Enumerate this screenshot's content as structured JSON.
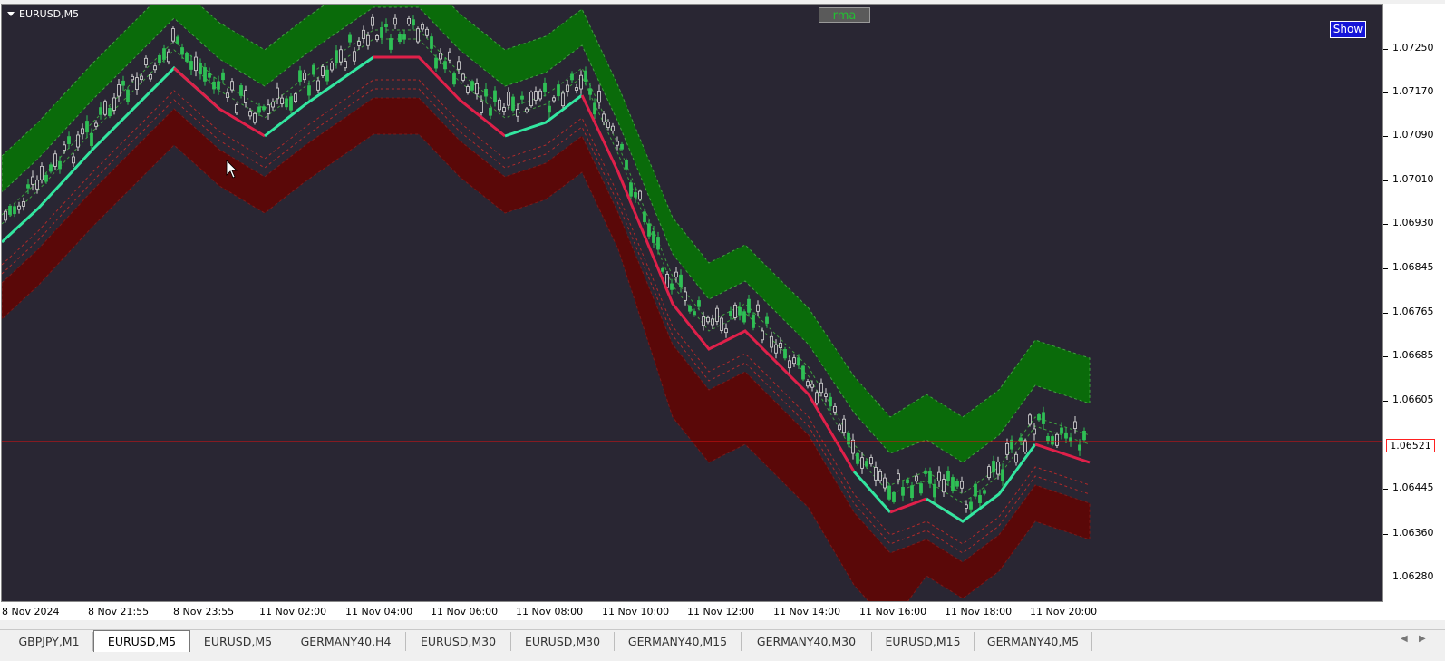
{
  "chart": {
    "symbol_title": "EURUSD,M5",
    "indicator_label": "rma",
    "show_button": "Show",
    "current_price": "1.06521",
    "price_ticks": [
      "1.07250",
      "1.07170",
      "1.07090",
      "1.07010",
      "1.06930",
      "1.06845",
      "1.06765",
      "1.06685",
      "1.06605",
      "1.06445",
      "1.06360",
      "1.06280"
    ],
    "time_ticks": [
      "8 Nov 2024",
      "8 Nov 21:55",
      "8 Nov 23:55",
      "11 Nov 02:00",
      "11 Nov 04:00",
      "11 Nov 06:00",
      "11 Nov 08:00",
      "11 Nov 10:00",
      "11 Nov 12:00",
      "11 Nov 14:00",
      "11 Nov 16:00",
      "11 Nov 18:00",
      "11 Nov 20:00"
    ],
    "colors": {
      "background": "#292633",
      "upper_band": "#0a6b0a",
      "lower_band": "#5a0808",
      "ma_up": "#33e6a0",
      "ma_down": "#e0204a",
      "price_line": "#e01010",
      "candle_up": "#2fbf55",
      "candle_down": "#d8d8d8"
    }
  },
  "chart_data": {
    "type": "line",
    "title": "EURUSD,M5",
    "x": [
      "8 Nov 2024",
      "8 Nov 21:55",
      "8 Nov 23:55",
      "11 Nov 02:00",
      "11 Nov 04:00",
      "11 Nov 06:00",
      "11 Nov 08:00",
      "11 Nov 10:00",
      "11 Nov 12:00",
      "11 Nov 14:00",
      "11 Nov 16:00",
      "11 Nov 18:00",
      "11 Nov 20:00"
    ],
    "ylim": [
      1.0622,
      1.0735
    ],
    "series": [
      {
        "name": "rma",
        "values": [
          1.0692,
          1.0712,
          1.0722,
          1.0711,
          1.0725,
          1.0712,
          1.0717,
          1.0688,
          1.0671,
          1.065,
          1.064,
          1.0638,
          1.0652
        ]
      },
      {
        "values": [
          1.0715,
          1.0722,
          1.0726,
          1.0716,
          1.0728,
          1.0716,
          1.0719,
          1.0693,
          1.0677,
          1.0655,
          1.065,
          1.0649,
          1.0655
        ]
      }
    ],
    "current_price": 1.06521,
    "grid": false
  },
  "tabs": [
    {
      "label": "GBPJPY,M1",
      "active": false
    },
    {
      "label": "EURUSD,M5",
      "active": true
    },
    {
      "label": "EURUSD,M5",
      "active": false
    },
    {
      "label": "GERMANY40,H4",
      "active": false
    },
    {
      "label": "EURUSD,M30",
      "active": false
    },
    {
      "label": "EURUSD,M30",
      "active": false
    },
    {
      "label": "GERMANY40,M15",
      "active": false
    },
    {
      "label": "GERMANY40,M30",
      "active": false
    },
    {
      "label": "EURUSD,M15",
      "active": false
    },
    {
      "label": "GERMANY40,M5",
      "active": false
    }
  ],
  "tab_nav": {
    "left": "◀",
    "right": "▶"
  }
}
